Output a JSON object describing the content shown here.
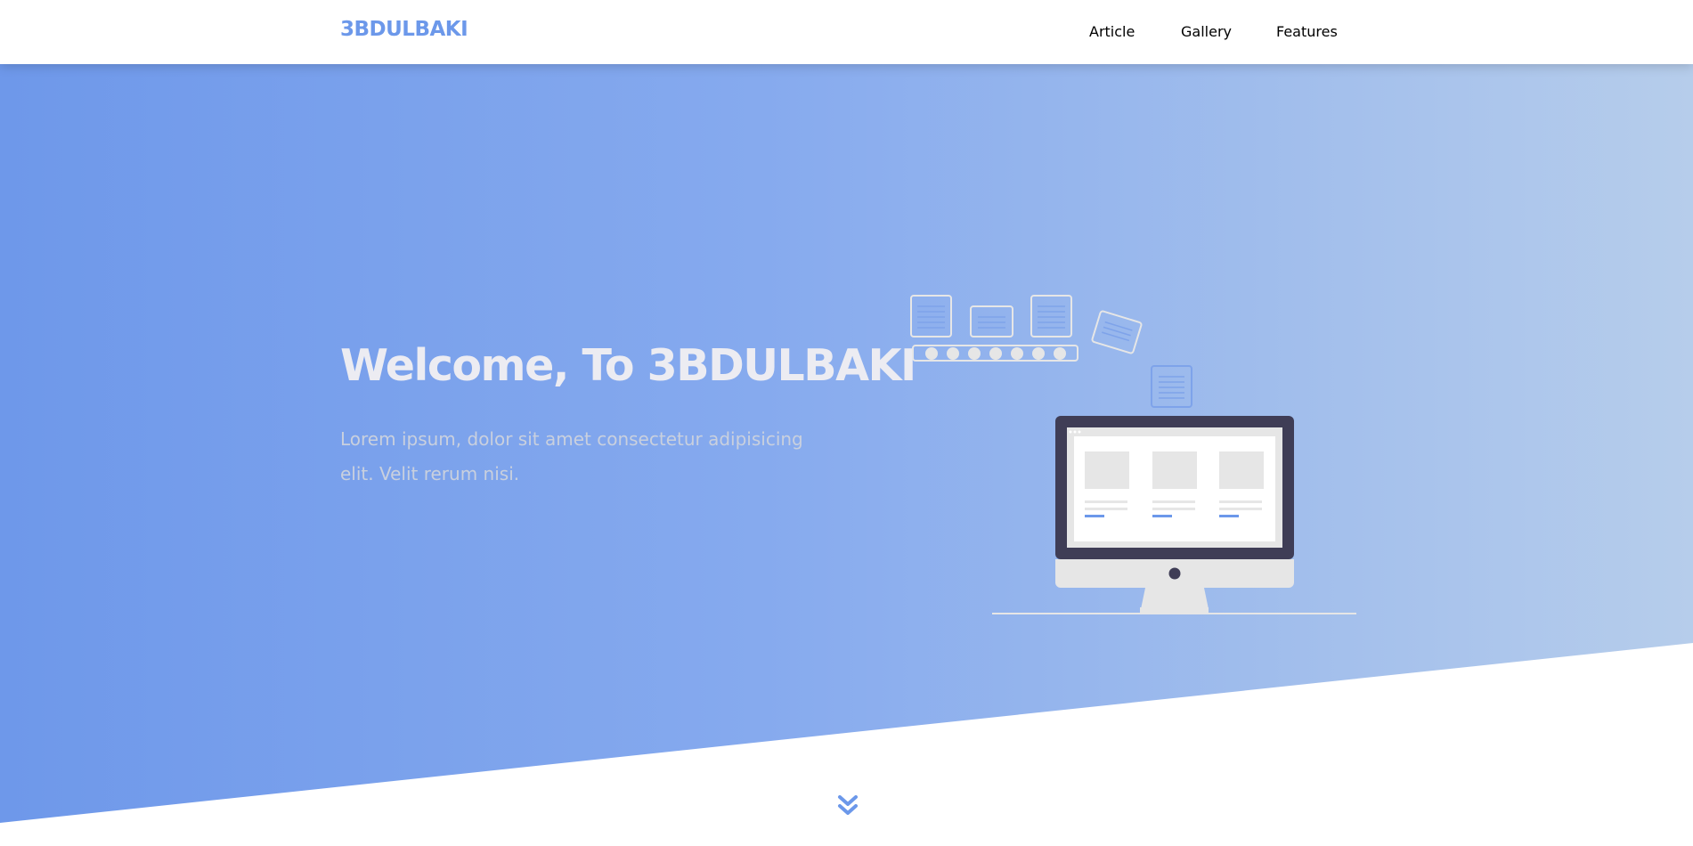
{
  "colors": {
    "accent": "#6c98ea",
    "gradient_start": "#6e98ea",
    "gradient_mid": "#86aaee",
    "gradient_end": "#b6cdeb",
    "title_text": "#ececf2",
    "body_text": "#c9d0de",
    "monitor_dark": "#3f3d56",
    "screen_gray": "#e6e6e6"
  },
  "header": {
    "logo": "3BDULBAKI",
    "nav": [
      {
        "label": "Article"
      },
      {
        "label": "Gallery"
      },
      {
        "label": "Features"
      }
    ]
  },
  "hero": {
    "title": "Welcome, To 3BDULBAKI",
    "description": "Lorem ipsum, dolor sit amet consectetur adipisicing elit. Velit rerum nisi."
  },
  "icons": {
    "scroll": "double-chevron-down-icon",
    "illustration": "monitor-conveyor-illustration"
  }
}
